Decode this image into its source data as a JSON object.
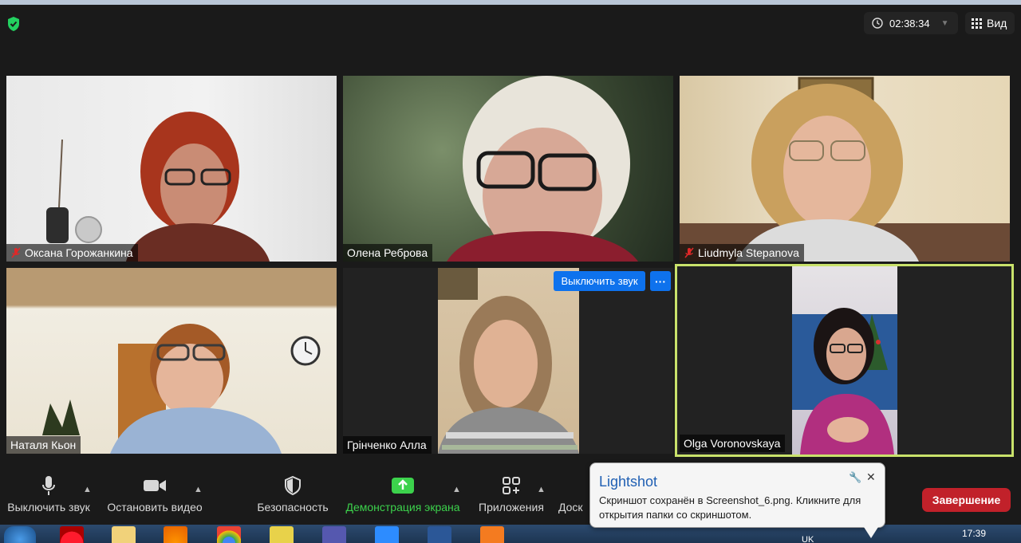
{
  "window": {
    "timer": "02:38:34",
    "view_label": "Вид"
  },
  "participants": [
    {
      "name": "Оксана Горожанкина",
      "muted": true
    },
    {
      "name": "Олена Реброва",
      "muted": false
    },
    {
      "name": "Liudmyla Stepanova",
      "muted": true
    },
    {
      "name": "Наталя Кьон",
      "muted": false
    },
    {
      "name": "Грінченко Алла",
      "muted": false
    },
    {
      "name": "Olga Voronovskaya",
      "muted": false
    }
  ],
  "hover_controls": {
    "unmute_label": "Выключить звук",
    "more_label": "···"
  },
  "toolbar": {
    "mute_label": "Выключить звук",
    "video_label": "Остановить видео",
    "security_label": "Безопасность",
    "share_label": "Демонстрация экрана",
    "apps_label": "Приложения",
    "whiteboard_label": "Доск",
    "end_label": "Завершение"
  },
  "lightshot": {
    "title": "Lightshot",
    "message": "Скриншот сохранён в Screenshot_6.png. Кликните для открытия папки со скриншотом."
  },
  "taskbar": {
    "clock": "17:39",
    "lang": "UK"
  },
  "colors": {
    "active_speaker": "#c9e26b",
    "end_button": "#c1212a",
    "share_green": "#3cd24c",
    "zoom_blue": "#0e72ed"
  }
}
